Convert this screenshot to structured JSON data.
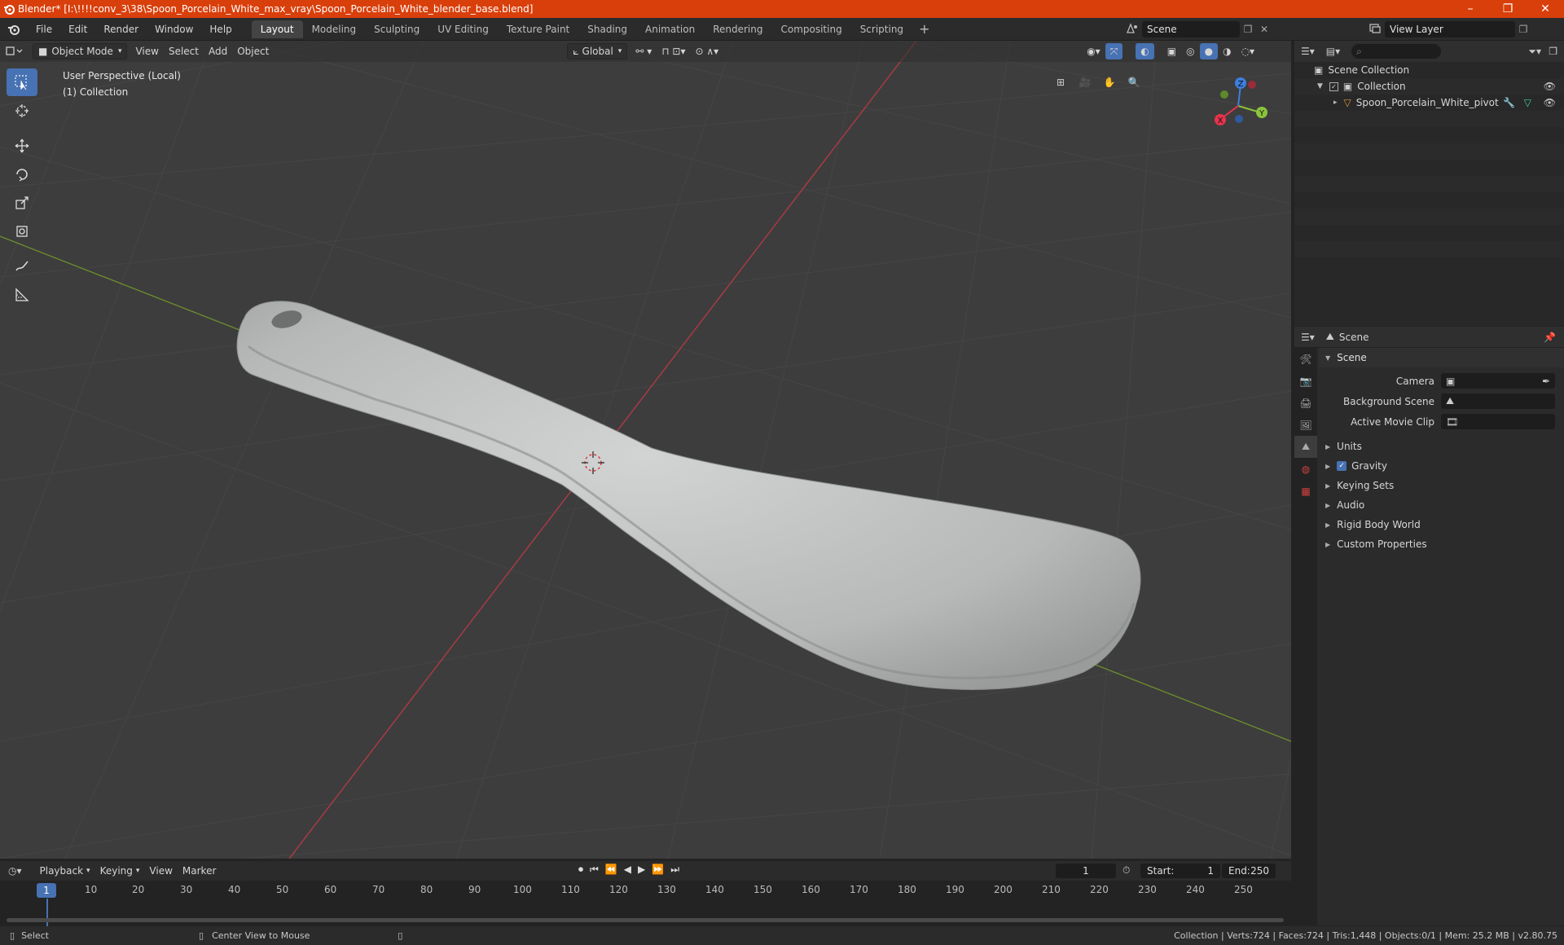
{
  "window": {
    "title": "Blender* [I:\\!!!!conv_3\\38\\Spoon_Porcelain_White_max_vray\\Spoon_Porcelain_White_blender_base.blend]",
    "minimize": "–",
    "maximize": "❐",
    "close": "✕"
  },
  "menu": {
    "items": [
      "File",
      "Edit",
      "Render",
      "Window",
      "Help"
    ]
  },
  "workspaces": {
    "tabs": [
      "Layout",
      "Modeling",
      "Sculpting",
      "UV Editing",
      "Texture Paint",
      "Shading",
      "Animation",
      "Rendering",
      "Compositing",
      "Scripting"
    ],
    "active": "Layout",
    "add": "+"
  },
  "scene_selector": {
    "value": "Scene"
  },
  "view_layer_selector": {
    "value": "View Layer"
  },
  "viewport": {
    "mode": "Object Mode",
    "menus": [
      "View",
      "Select",
      "Add",
      "Object"
    ],
    "orientation": "Global",
    "info_line1": "User Perspective (Local)",
    "info_line2": "(1) Collection",
    "axis_x": "X",
    "axis_y": "Y",
    "axis_z": "Z"
  },
  "outliner": {
    "scene_collection": "Scene Collection",
    "collection": "Collection",
    "object": "Spoon_Porcelain_White_pivot"
  },
  "properties": {
    "header": "Scene",
    "panel_scene": "Scene",
    "camera_label": "Camera",
    "bg_scene_label": "Background Scene",
    "movie_clip_label": "Active Movie Clip",
    "units": "Units",
    "gravity": "Gravity",
    "gravity_enabled": true,
    "keying_sets": "Keying Sets",
    "audio": "Audio",
    "rigid_body": "Rigid Body World",
    "custom_props": "Custom Properties"
  },
  "timeline": {
    "menus": [
      "Playback",
      "Keying",
      "View",
      "Marker"
    ],
    "current_frame": "1",
    "start_label": "Start:",
    "start": "1",
    "end_label": "End:",
    "end": "250",
    "ticks": [
      "1",
      "10",
      "20",
      "30",
      "40",
      "50",
      "60",
      "70",
      "80",
      "90",
      "100",
      "110",
      "120",
      "130",
      "140",
      "150",
      "160",
      "170",
      "180",
      "190",
      "200",
      "210",
      "220",
      "230",
      "240",
      "250"
    ]
  },
  "status": {
    "select": "Select",
    "center_view": "Center View to Mouse",
    "stats": "Collection | Verts:724 | Faces:724 | Tris:1,448 | Objects:0/1 | Mem: 25.2 MB | v2.80.75"
  },
  "colors": {
    "title_bar": "#d93f0b",
    "accent": "#4772b3",
    "x_axis": "#e6334d",
    "y_axis": "#8cc43d",
    "z_axis": "#3c7fe0"
  }
}
